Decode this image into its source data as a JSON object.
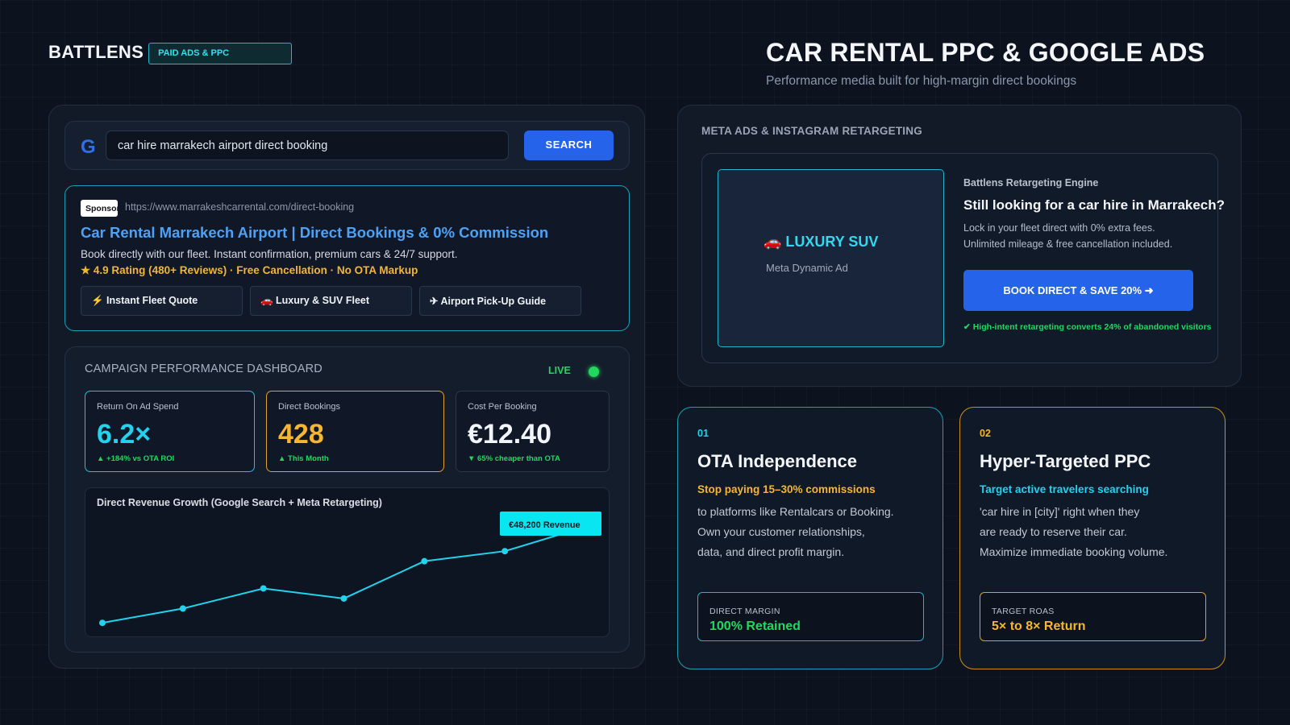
{
  "brand": {
    "name": "BATTLENS",
    "badge": "PAID ADS & PPC"
  },
  "header": {
    "title": "CAR RENTAL PPC & GOOGLE ADS",
    "subtitle": "Performance media built for high-margin direct bookings"
  },
  "search": {
    "logo": "G",
    "query": "car hire marrakech airport direct booking",
    "button_label": "SEARCH"
  },
  "ad": {
    "sponsor_label": "Sponsored",
    "url": "https://www.marrakeshcarrental.com/direct-booking",
    "title": "Car Rental Marrakech Airport | Direct Bookings & 0% Commission",
    "description": "Book directly with our fleet. Instant confirmation, premium cars & 24/7 support.",
    "rating": "★ 4.9 Rating (480+ Reviews) · Free Cancellation · No OTA Markup",
    "sitelinks": [
      "⚡ Instant Fleet Quote",
      "🚗 Luxury & SUV Fleet",
      "✈ Airport Pick-Up Guide"
    ]
  },
  "dashboard": {
    "title": "CAMPAIGN PERFORMANCE DASHBOARD",
    "live_label": "LIVE",
    "stats": [
      {
        "label": "Return On Ad Spend",
        "value": "6.2×",
        "note": "▲ +184% vs OTA ROI",
        "color": "#22d3ee"
      },
      {
        "label": "Direct Bookings",
        "value": "428",
        "note": "▲ This Month",
        "color": "#f5b632"
      },
      {
        "label": "Cost Per Booking",
        "value": "€12.40",
        "note": "▼ 65% cheaper than OTA",
        "color": "#f2f5f9"
      }
    ]
  },
  "chart_data": {
    "type": "line",
    "title": "Direct Revenue Growth (Google Search + Meta Retargeting)",
    "series": [
      {
        "values": [
          10,
          20,
          34,
          27,
          53,
          60,
          77
        ]
      }
    ],
    "ylim": [
      0,
      100
    ],
    "grid": false,
    "annotation": "€48,200 Revenue",
    "line_color": "#22d3ee"
  },
  "meta": {
    "section_title": "META ADS & INSTAGRAM RETARGETING",
    "creative_label": "🚗 LUXURY SUV",
    "creative_sub": "Meta Dynamic Ad",
    "engine_label": "Battlens Retargeting Engine",
    "headline": "Still looking for a car hire in Marrakech?",
    "copy_line1": "Lock in your fleet direct with 0% extra fees.",
    "copy_line2": "Unlimited mileage & free cancellation included.",
    "cta": "BOOK DIRECT & SAVE 20% ➜",
    "note": "✔ High-intent retargeting converts 24% of abandoned visitors"
  },
  "features": [
    {
      "number": "01",
      "title": "OTA Independence",
      "lead": "Stop paying 15–30% commissions",
      "body": [
        "to platforms like Rentalcars or Booking.",
        "Own your customer relationships,",
        "data, and direct profit margin."
      ],
      "metric_label": "DIRECT MARGIN",
      "metric_value": "100% Retained",
      "accent": "#22d3ee",
      "metric_color": "#22d85e"
    },
    {
      "number": "02",
      "title": "Hyper-Targeted PPC",
      "lead": "Target active travelers searching",
      "body": [
        "'car hire in [city]' right when they",
        "are ready to reserve their car.",
        "Maximize immediate booking volume."
      ],
      "metric_label": "TARGET ROAS",
      "metric_value": "5× to 8× Return",
      "accent": "#f5b632",
      "metric_color": "#f5b632"
    }
  ]
}
